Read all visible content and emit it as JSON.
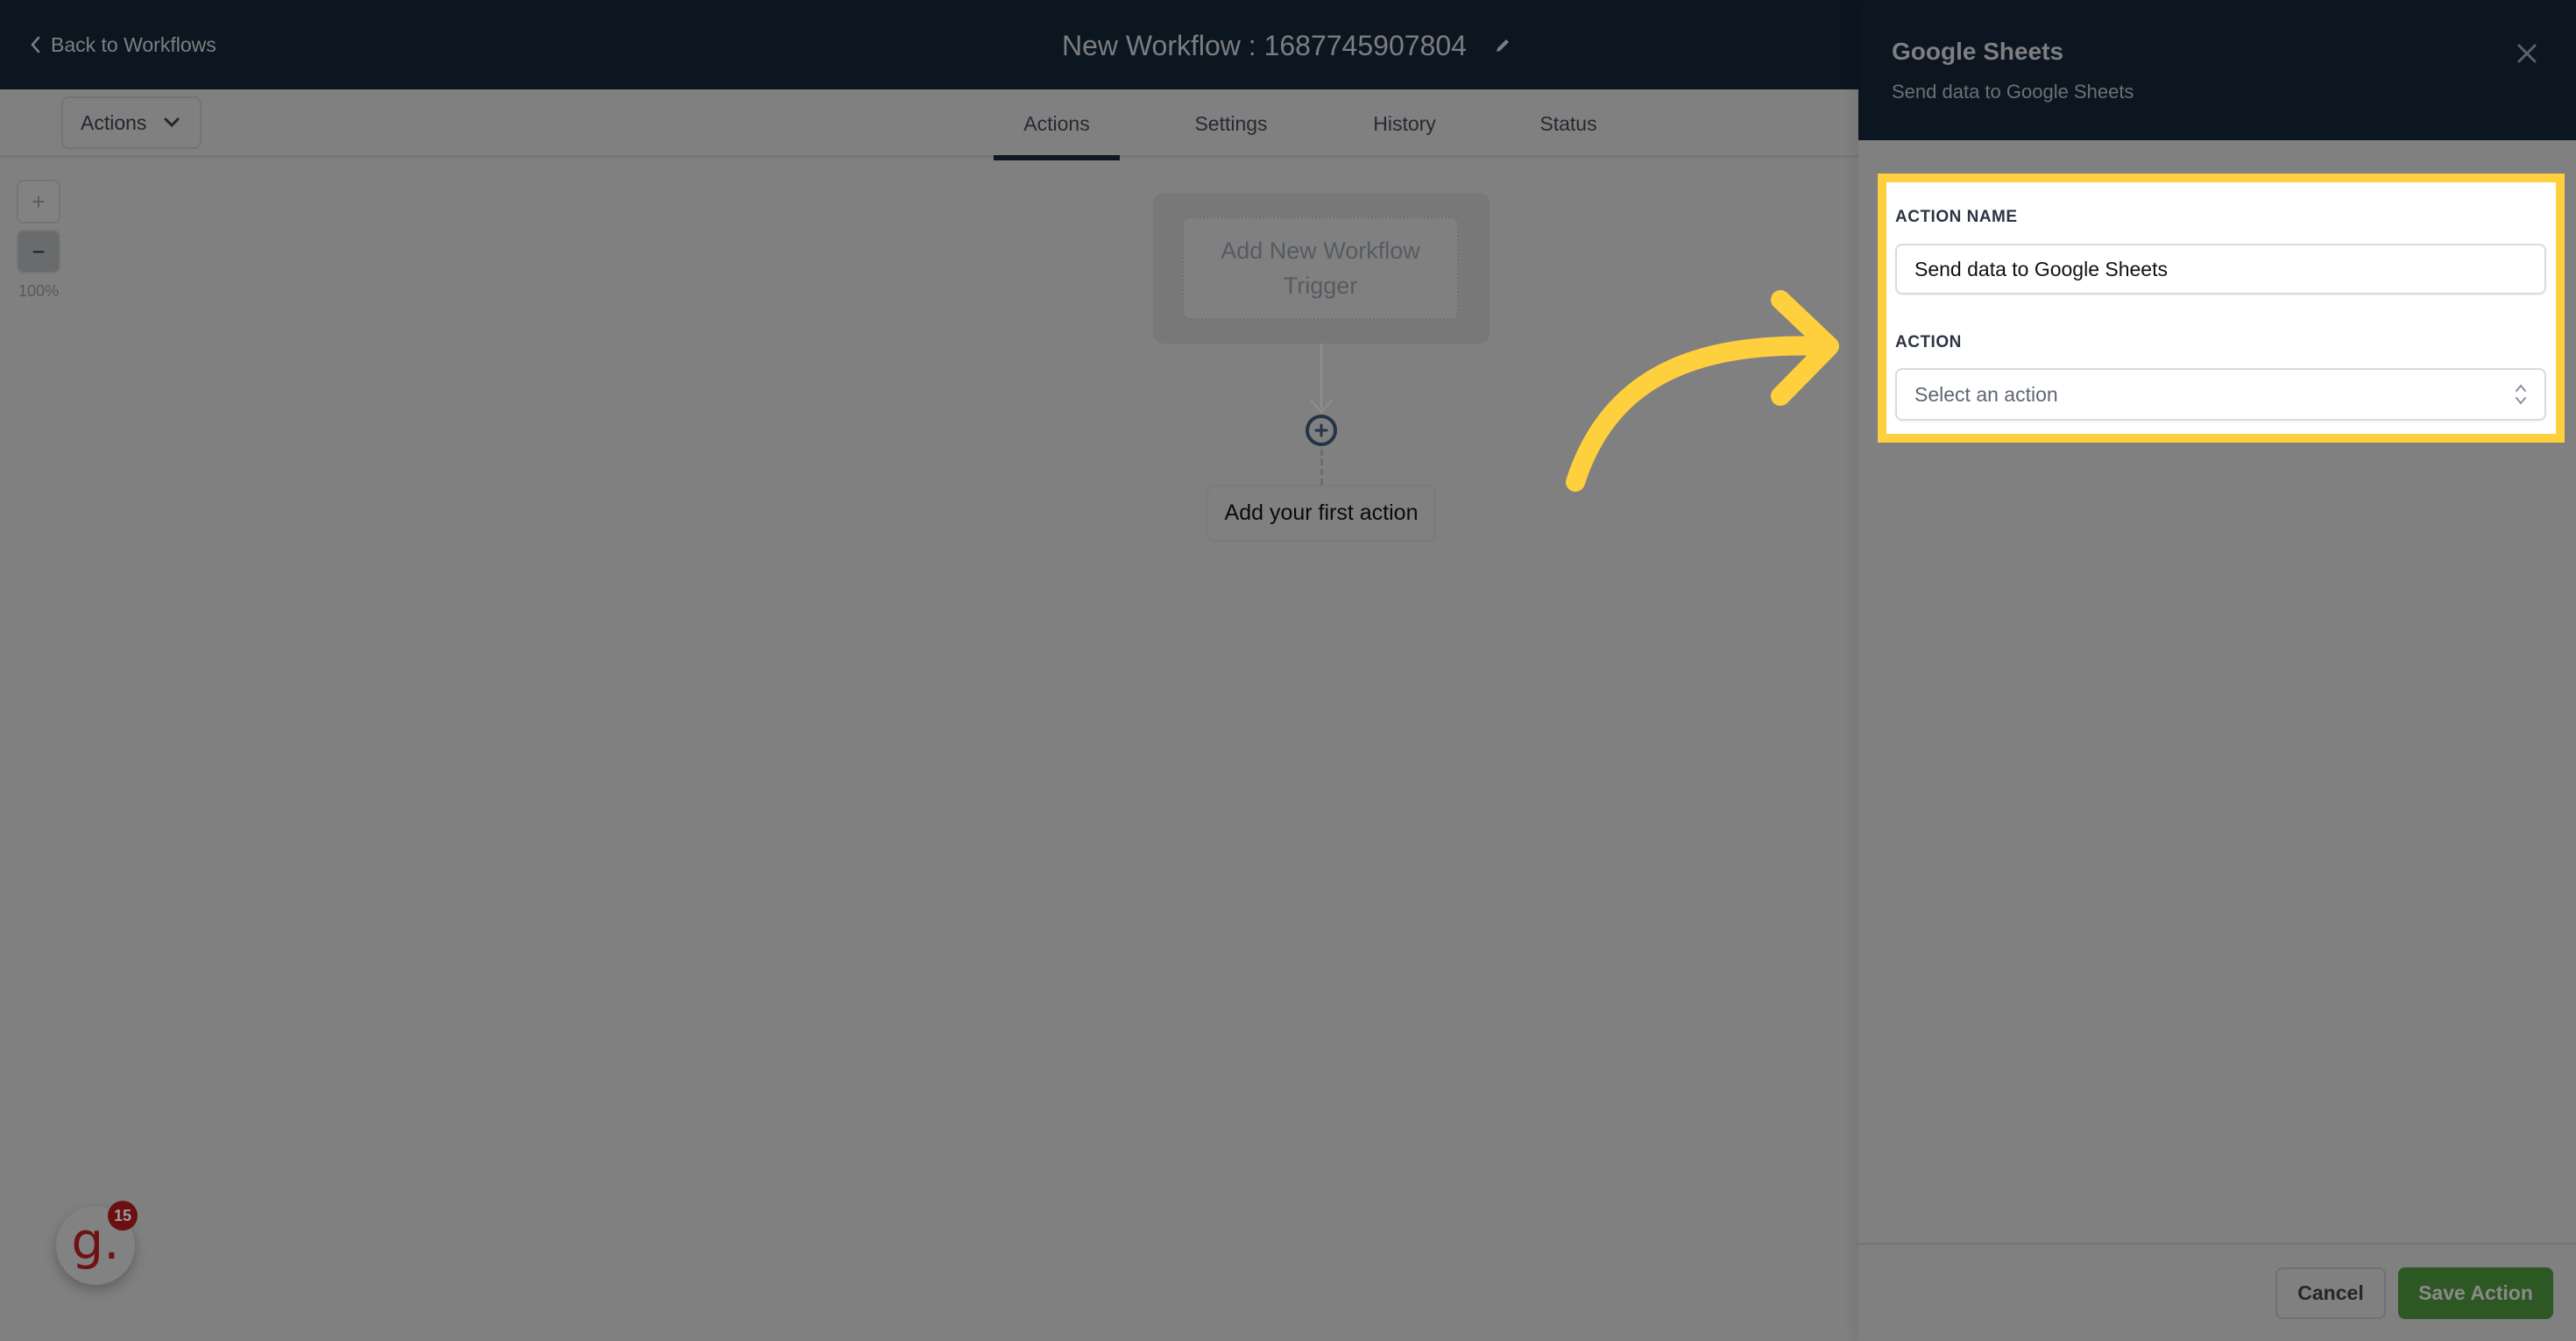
{
  "header": {
    "back_label": "Back to Workflows",
    "workflow_title": "New Workflow : 1687745907804",
    "icons": {
      "back": "chevron-left-icon",
      "edit": "pencil-icon"
    }
  },
  "toolbar": {
    "actions_dropdown_label": "Actions",
    "tabs": [
      {
        "label": "Actions",
        "active": true
      },
      {
        "label": "Settings",
        "active": false
      },
      {
        "label": "History",
        "active": false
      },
      {
        "label": "Status",
        "active": false
      }
    ]
  },
  "canvas": {
    "zoom_in_label": "+",
    "zoom_out_label": "−",
    "zoom_level": "100%",
    "trigger_card_label": "Add New Workflow Trigger",
    "add_first_action_label": "Add your first action"
  },
  "help_widget": {
    "logo_letter": "g.",
    "badge_count": "15"
  },
  "panel": {
    "title": "Google Sheets",
    "subtitle": "Send data to Google Sheets",
    "action_name_label": "ACTION NAME",
    "action_name_value": "Send data to Google Sheets",
    "action_label": "ACTION",
    "action_select_placeholder": "Select an action",
    "cancel_label": "Cancel",
    "save_label": "Save Action"
  },
  "colors": {
    "header_bg": "#0c1620",
    "highlight": "#ffd03e",
    "save_button": "#2d5723",
    "overlay_gray": "#808080"
  }
}
